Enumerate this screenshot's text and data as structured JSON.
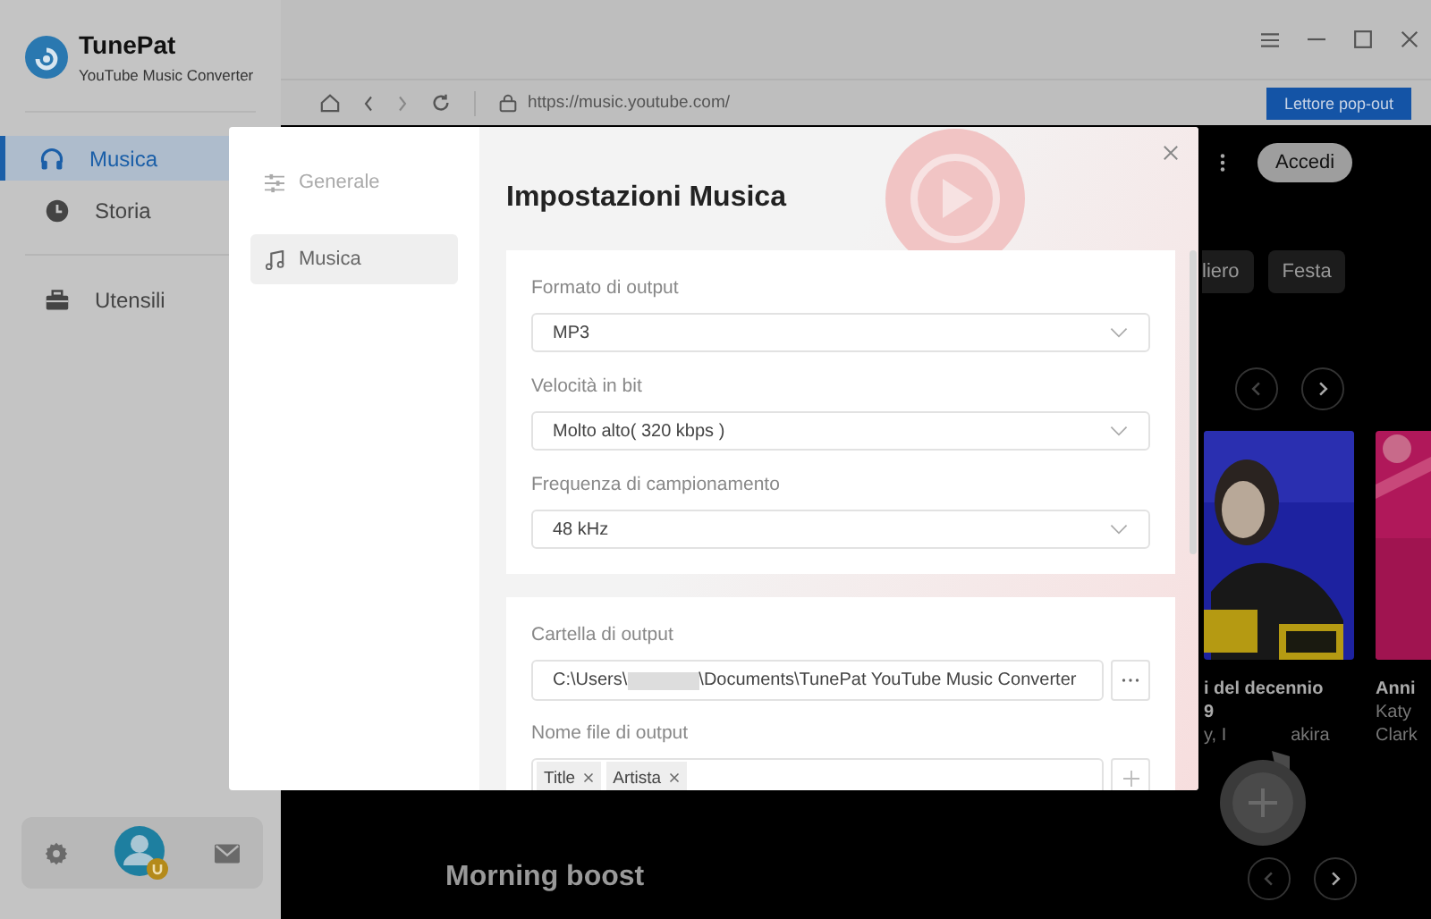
{
  "app": {
    "name": "TunePat",
    "subtitle": "YouTube Music Converter"
  },
  "sidebar": {
    "items": [
      {
        "label": "Musica",
        "selected": true
      },
      {
        "label": "Storia",
        "selected": false
      }
    ],
    "tools": [
      {
        "label": "Utensili",
        "selected": false
      }
    ]
  },
  "toolbar": {
    "url": "https://music.youtube.com/",
    "popout_button": "Lettore pop-out"
  },
  "modal": {
    "nav": [
      {
        "label": "Generale",
        "selected": false
      },
      {
        "label": "Musica",
        "selected": true
      }
    ],
    "title": "Impostazioni Musica",
    "audio_settings": [
      {
        "label": "Formato di output",
        "value": "MP3"
      },
      {
        "label": "Velocità in bit",
        "value": "Molto alto( 320 kbps )"
      },
      {
        "label": "Frequenza di campionamento",
        "value": "48 kHz"
      }
    ],
    "output_folder": {
      "label": "Cartella di output",
      "path_start": "C:\\Users\\",
      "path_end": "\\Documents\\TunePat YouTube Music Converter"
    },
    "file_name": {
      "label": "Nome file di output",
      "tags": [
        "Title",
        "Artista"
      ]
    }
  },
  "content": {
    "account_button": "Accedi",
    "chips": [
      "liero",
      "Festa"
    ],
    "cards": [
      {
        "kind": "picture",
        "lines": [
          {
            "kind": "title",
            "parts": [
              "i del decennio"
            ]
          },
          {
            "kind": "title",
            "parts": [
              "9"
            ]
          },
          {
            "kind": "subtitle",
            "parts": [
              "y, I",
              "akira"
            ]
          }
        ]
      },
      {
        "kind": "picture",
        "lines": [
          {
            "kind": "title",
            "parts": [
              "Anni"
            ]
          },
          {
            "kind": "subtitle",
            "parts": [
              "Katy"
            ]
          },
          {
            "kind": "subtitle",
            "parts": [
              "Clark"
            ]
          }
        ]
      }
    ],
    "section_title": "Morning boost"
  }
}
